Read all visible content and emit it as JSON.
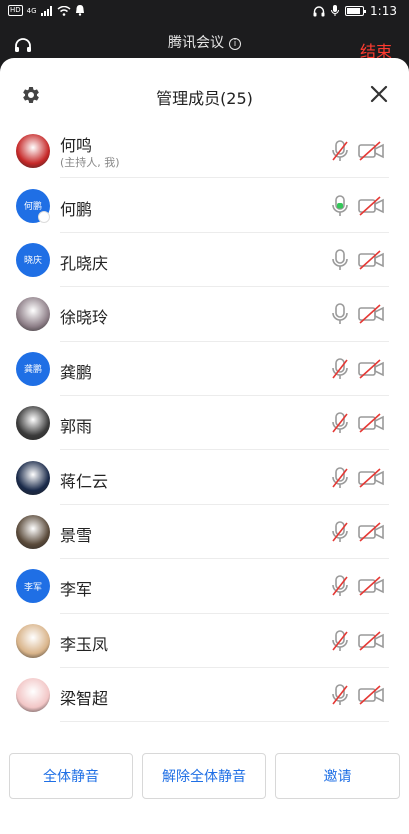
{
  "status_bar": {
    "time": "1:13",
    "network_chip": "HD",
    "network_type": "4G",
    "icons": [
      "signal-icon",
      "wifi-icon",
      "notification-icon",
      "headphones-icon",
      "mic-icon",
      "battery-icon"
    ]
  },
  "meeting_bar": {
    "title": "腾讯会议",
    "info_glyph": "i",
    "end_label": "结束",
    "end_color": "#ff3b30"
  },
  "panel": {
    "title": "管理成员(25)"
  },
  "members": [
    {
      "name": "何鸣",
      "subtitle": "(主持人, 我)",
      "avatar_type": "photo",
      "avatar_color": "#c62828",
      "mic": "muted",
      "camera": "off"
    },
    {
      "name": "何鹏",
      "subtitle": "",
      "avatar_type": "text",
      "avatar_text": "何鹏",
      "mic": "speaking",
      "camera": "off"
    },
    {
      "name": "孔晓庆",
      "subtitle": "",
      "avatar_type": "text",
      "avatar_text": "晓庆",
      "mic": "on",
      "camera": "off"
    },
    {
      "name": "徐晓玲",
      "subtitle": "",
      "avatar_type": "photo",
      "avatar_color": "#8e7f88",
      "mic": "on",
      "camera": "off"
    },
    {
      "name": "龚鹏",
      "subtitle": "",
      "avatar_type": "text",
      "avatar_text": "龚鹏",
      "mic": "muted",
      "camera": "off"
    },
    {
      "name": "郭雨",
      "subtitle": "",
      "avatar_type": "photo",
      "avatar_color": "#3b3b3b",
      "mic": "muted",
      "camera": "off"
    },
    {
      "name": "蒋仁云",
      "subtitle": "",
      "avatar_type": "photo",
      "avatar_color": "#1a2a4a",
      "mic": "muted",
      "camera": "off"
    },
    {
      "name": "景雪",
      "subtitle": "",
      "avatar_type": "photo",
      "avatar_color": "#5a4a3a",
      "mic": "muted",
      "camera": "off"
    },
    {
      "name": "李军",
      "subtitle": "",
      "avatar_type": "text",
      "avatar_text": "李军",
      "mic": "muted",
      "camera": "off"
    },
    {
      "name": "李玉凤",
      "subtitle": "",
      "avatar_type": "photo",
      "avatar_color": "#d9b48a",
      "mic": "muted",
      "camera": "off"
    },
    {
      "name": "梁智超",
      "subtitle": "",
      "avatar_type": "photo",
      "avatar_color": "#f2c6c6",
      "mic": "muted",
      "camera": "off"
    }
  ],
  "colors": {
    "accent": "#1f6fe5",
    "muted_slash": "#e53935",
    "speaking": "#34c759"
  },
  "footer": {
    "mute_all": "全体静音",
    "unmute_all": "解除全体静音",
    "invite": "邀请"
  }
}
